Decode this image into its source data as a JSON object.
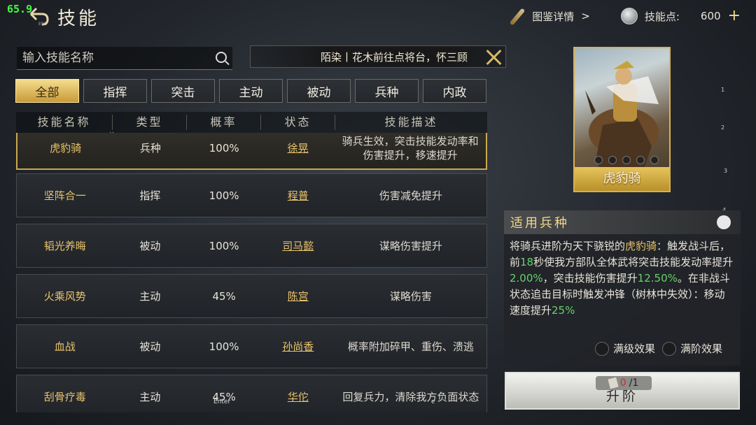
{
  "hud": {
    "fps": "65.9",
    "esc_label": "ESC"
  },
  "header": {
    "title": "技能",
    "codex_label": "图鉴详情",
    "codex_arrow": ">",
    "skill_points_label": "技能点:",
    "skill_points_value": "600",
    "plus": "+"
  },
  "search": {
    "placeholder": "输入技能名称"
  },
  "marquee": {
    "text": "陌染丨花木前往点将台，怀三顾"
  },
  "tabs": [
    {
      "label": "全部",
      "active": true
    },
    {
      "label": "指挥"
    },
    {
      "label": "突击"
    },
    {
      "label": "主动"
    },
    {
      "label": "被动"
    },
    {
      "label": "兵种"
    },
    {
      "label": "内政"
    }
  ],
  "table": {
    "headers": [
      "技能名称",
      "类型",
      "概率",
      "状态",
      "技能描述"
    ],
    "sort_glyph": "v",
    "rows": [
      {
        "name": "虎豹骑",
        "type": "兵种",
        "rate": "100%",
        "status": "徐晃",
        "desc": "骑兵生效，突击技能发动率和伤害提升，移速提升",
        "selected": true
      },
      {
        "name": "坚阵合一",
        "type": "指挥",
        "rate": "100%",
        "status": "程普",
        "desc": "伤害减免提升"
      },
      {
        "name": "韬光养晦",
        "type": "被动",
        "rate": "100%",
        "status": "司马懿",
        "desc": "谋略伤害提升"
      },
      {
        "name": "火乘风势",
        "type": "主动",
        "rate": "45%",
        "status": "陈宫",
        "desc": "谋略伤害"
      },
      {
        "name": "血战",
        "type": "被动",
        "rate": "100%",
        "status": "孙尚香",
        "desc": "概率附加碎甲、重伤、溃逃"
      },
      {
        "name": "刮骨疗毒",
        "type": "主动",
        "rate": "45%",
        "status": "华佗",
        "desc": "回复兵力，清除我方负面状态"
      }
    ]
  },
  "card": {
    "name": "虎豹骑"
  },
  "page_indicators": [
    "1",
    "2",
    "3",
    "4"
  ],
  "info": {
    "header": "适用兵种",
    "parts": [
      {
        "t": "将骑兵进阶为天下骁锐的",
        "c": ""
      },
      {
        "t": "虎豹骑",
        "c": "gold"
      },
      {
        "t": "：触发战斗后，前",
        "c": ""
      },
      {
        "t": "18",
        "c": "green"
      },
      {
        "t": "秒使我方部队全体武将突击技能发动率提升",
        "c": ""
      },
      {
        "t": "2.00%",
        "c": "green"
      },
      {
        "t": "，突击技能伤害提升",
        "c": ""
      },
      {
        "t": "12.50%",
        "c": "green"
      },
      {
        "t": "。在非战斗状态追击目标时触发冲锋（树林中失效）：移动速度提升",
        "c": ""
      },
      {
        "t": "25%",
        "c": "green"
      }
    ],
    "option_max_level": "满级效果",
    "option_max_rank": "满阶效果"
  },
  "upgrade": {
    "label": "升阶",
    "cost_have": "0",
    "cost_need": "/1"
  },
  "debug_glyphs": {
    "s": "s",
    "c": "c",
    "enter": "Enter"
  }
}
